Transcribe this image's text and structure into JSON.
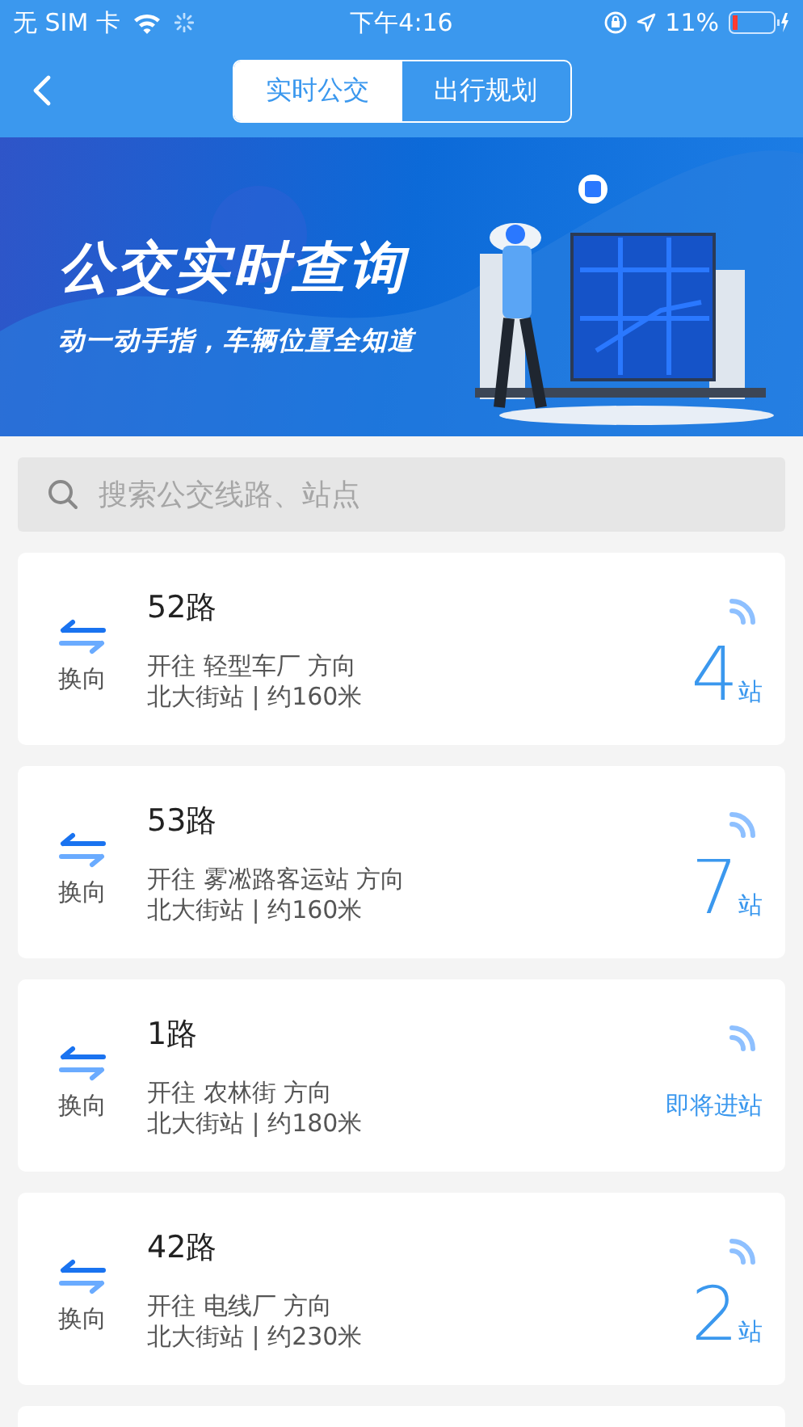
{
  "status_bar": {
    "carrier": "无 SIM 卡",
    "time": "下午4:16",
    "battery": "11%"
  },
  "tabs": [
    {
      "label": "实时公交",
      "selected": true
    },
    {
      "label": "出行规划",
      "selected": false
    }
  ],
  "banner": {
    "title": "公交实时查询",
    "subtitle": "动一动手指，车辆位置全知道"
  },
  "search": {
    "placeholder": "搜索公交线路、站点"
  },
  "routes": [
    {
      "swap_label": "换向",
      "name": "52路",
      "direction": "开往 轻型车厂 方向",
      "stop": "北大街站 | 约160米",
      "kind": "count",
      "count": "4",
      "unit": "站"
    },
    {
      "swap_label": "换向",
      "name": "53路",
      "direction": "开往 雾凇路客运站 方向",
      "stop": "北大街站 | 约160米",
      "kind": "count",
      "count": "7",
      "unit": "站"
    },
    {
      "swap_label": "换向",
      "name": "1路",
      "direction": "开往 农林街 方向",
      "stop": "北大街站 | 约180米",
      "kind": "arriving",
      "status": "即将进站"
    },
    {
      "swap_label": "换向",
      "name": "42路",
      "direction": "开往 电线厂 方向",
      "stop": "北大街站 | 约230米",
      "kind": "count",
      "count": "2",
      "unit": "站"
    }
  ]
}
